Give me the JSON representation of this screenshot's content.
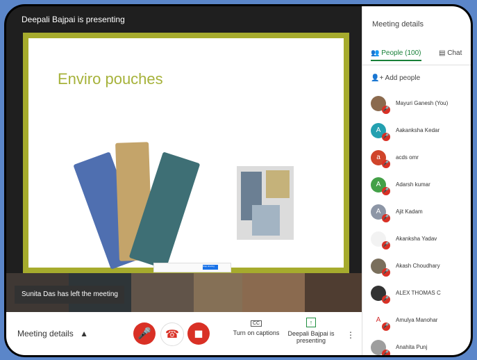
{
  "stage": {
    "presenter_label": "Deepali Bajpai is presenting",
    "slide_title": "Enviro pouches",
    "share_stop_label": "Stop sharing"
  },
  "toast": "Sunita Das has left the meeting",
  "controls": {
    "meeting_details": "Meeting details",
    "captions_label": "Turn on captions",
    "presenting_label": "Deepali Bajpai is presenting"
  },
  "sidebar": {
    "title": "Meeting details",
    "people_tab": "People (100)",
    "chat_tab": "Chat",
    "add_people": "Add people",
    "people": [
      {
        "name": "Mayuri Ganesh (You)",
        "initial": "",
        "color": "#8b6a4e"
      },
      {
        "name": "Aakanksha Kedar",
        "initial": "A",
        "color": "#23a0b0"
      },
      {
        "name": "acds omr",
        "initial": "a",
        "color": "#d0442a"
      },
      {
        "name": "Adarsh kumar",
        "initial": "A",
        "color": "#43a047"
      },
      {
        "name": "Ajit Kadam",
        "initial": "A",
        "color": "#8d96a6"
      },
      {
        "name": "Akanksha Yadav",
        "initial": "",
        "color": "#f2f2f2"
      },
      {
        "name": "Akash Choudhary",
        "initial": "",
        "color": "#7a6f5c"
      },
      {
        "name": "ALEX THOMAS C",
        "initial": "",
        "color": "#333"
      },
      {
        "name": "Amulya Manohar",
        "initial": "A",
        "color": "#fff"
      },
      {
        "name": "Anahita Punj",
        "initial": "",
        "color": "#9e9e9e"
      }
    ]
  }
}
